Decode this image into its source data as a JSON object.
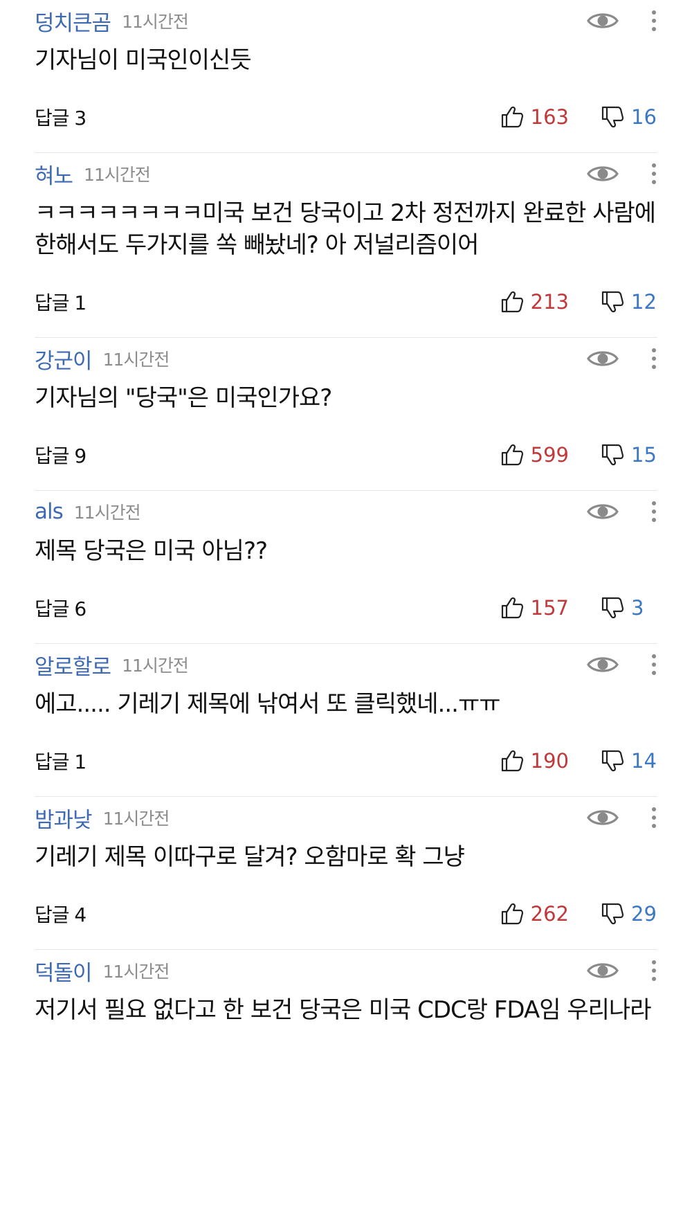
{
  "comments": [
    {
      "author": "덩치큰곰",
      "time": "11시간전",
      "text": "기자님이 미국인이신듯",
      "reply_label": "답글 3",
      "likes": "163",
      "dislikes": "16"
    },
    {
      "author": "혀노",
      "time": "11시간전",
      "text": "ㅋㅋㅋㅋㅋㅋㅋㅋ미국 보건 당국이고 2차 정전까지 완료한 사람에 한해서도 두가지를 쏙 빼놨네? 아 저널리즘이어",
      "reply_label": "답글 1",
      "likes": "213",
      "dislikes": "12"
    },
    {
      "author": "강군이",
      "time": "11시간전",
      "text": "기자님의 \"당국\"은 미국인가요?",
      "reply_label": "답글 9",
      "likes": "599",
      "dislikes": "15"
    },
    {
      "author": "als",
      "time": "11시간전",
      "text": "제목 당국은 미국 아님??",
      "reply_label": "답글 6",
      "likes": "157",
      "dislikes": "3"
    },
    {
      "author": "알로할로",
      "time": "11시간전",
      "text": "에고..... 기레기 제목에 낚여서 또 클릭했네...ㅠㅠ",
      "reply_label": "답글 1",
      "likes": "190",
      "dislikes": "14"
    },
    {
      "author": "밤과낮",
      "time": "11시간전",
      "text": "기레기 제목 이따구로 달겨? 오함마로 확 그냥",
      "reply_label": "답글 4",
      "likes": "262",
      "dislikes": "29"
    },
    {
      "author": "덕돌이",
      "time": "11시간전",
      "text": "저기서 필요 없다고 한 보건 당국은 미국 CDC랑 FDA임 우리나라",
      "reply_label": "",
      "likes": "",
      "dislikes": ""
    }
  ],
  "icons": {
    "view": "eye-icon",
    "more": "more-vertical-icon",
    "like": "thumbs-up-icon",
    "dislike": "thumbs-down-icon"
  },
  "colors": {
    "author": "#3d6ab2",
    "time": "#8c8c8c",
    "like_count": "#c0393b",
    "dislike_count": "#3d78c2",
    "divider": "#e6e6e6"
  }
}
